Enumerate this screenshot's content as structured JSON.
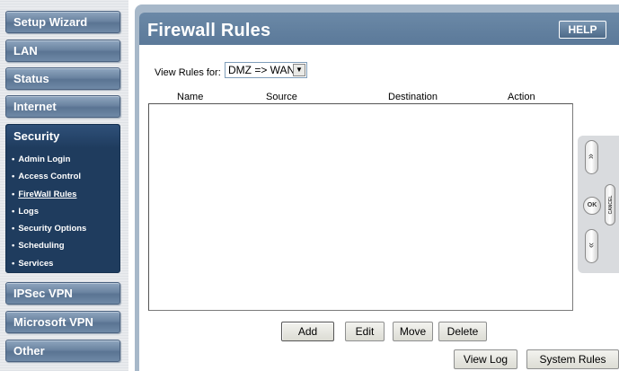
{
  "sidebar": {
    "top_items": [
      {
        "label": "Setup Wizard"
      },
      {
        "label": "LAN"
      },
      {
        "label": "Status"
      },
      {
        "label": "Internet"
      }
    ],
    "security": {
      "label": "Security",
      "items": [
        {
          "label": "Admin Login"
        },
        {
          "label": "Access Control"
        },
        {
          "label": "FireWall Rules"
        },
        {
          "label": "Logs"
        },
        {
          "label": "Security Options"
        },
        {
          "label": "Scheduling"
        },
        {
          "label": "Services"
        }
      ]
    },
    "bottom_items": [
      {
        "label": "IPSec VPN"
      },
      {
        "label": "Microsoft VPN"
      },
      {
        "label": "Other"
      }
    ],
    "bullet": "•"
  },
  "header": {
    "title": "Firewall Rules",
    "help_label": "HELP"
  },
  "filter": {
    "label": "View Rules for:",
    "selected": "DMZ => WAN"
  },
  "table": {
    "columns": [
      "Name",
      "Source",
      "Destination",
      "Action"
    ],
    "rows": []
  },
  "pad": {
    "up_icon": "double-chevron-up-icon",
    "down_icon": "double-chevron-down-icon",
    "up_glyph": "»",
    "down_glyph": "»",
    "ok_label": "OK",
    "cancel_label": "CANCEL"
  },
  "actions": {
    "add": "Add",
    "edit": "Edit",
    "move": "Move",
    "delete": "Delete",
    "view_log": "View Log",
    "system_rules": "System Rules"
  }
}
